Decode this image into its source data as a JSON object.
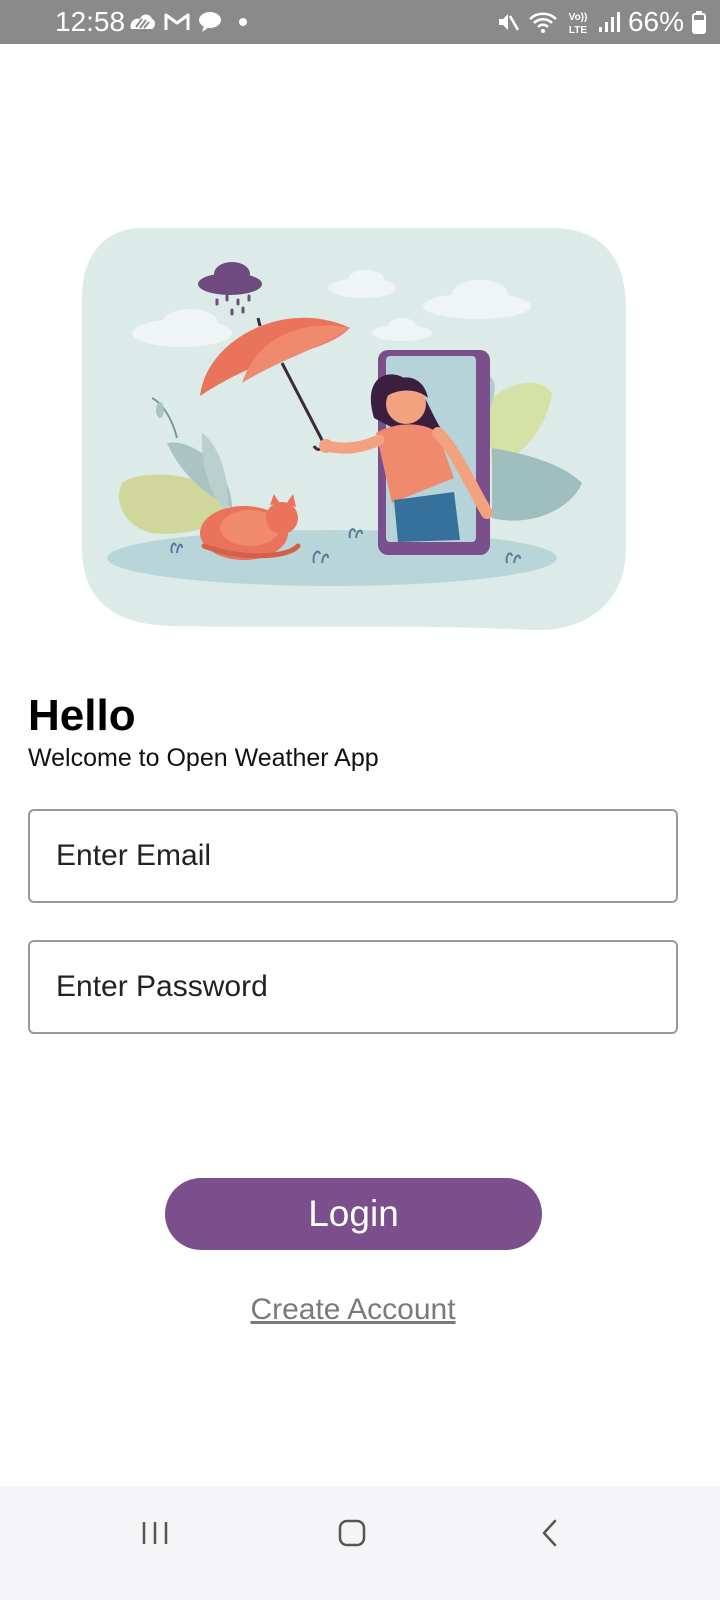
{
  "status_bar": {
    "time": "12:58",
    "battery": "66%",
    "left_icons": [
      "cloud-swirl-icon",
      "gmail-icon",
      "chat-bubble-icon",
      "dot-icon"
    ],
    "right_icons": [
      "mute-icon",
      "wifi-icon",
      "volte-icon",
      "signal-icon",
      "battery-icon"
    ],
    "volte_label_top": "Vo))",
    "volte_label_bottom": "LTE"
  },
  "hero": {
    "illustration": "woman-with-umbrella-in-phone-frame"
  },
  "greeting": {
    "title": "Hello",
    "subtitle": "Welcome to Open Weather App"
  },
  "form": {
    "email_placeholder": "Enter Email",
    "email_value": "",
    "password_placeholder": "Enter Password",
    "password_value": "",
    "login_label": "Login",
    "create_account_label": "Create Account"
  },
  "nav_bar": {
    "items": [
      "recent-apps-icon",
      "home-icon",
      "back-icon"
    ]
  },
  "colors": {
    "accent": "#7a4f8b",
    "status_bar": "#8a8a8a",
    "nav_bar": "#f5f5f7",
    "illustration_bg": "#dcebe8",
    "umbrella": "#e9735b",
    "cloud_dark": "#6e4a7e"
  }
}
